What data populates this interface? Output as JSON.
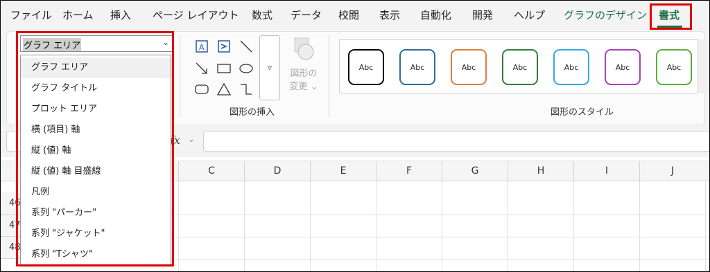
{
  "menu": {
    "items": [
      "ファイル",
      "ホーム",
      "挿入",
      "ページ レイアウト",
      "数式",
      "データ",
      "校閲",
      "表示",
      "自動化",
      "開発",
      "ヘルプ",
      "グラフのデザイン",
      "書式"
    ]
  },
  "ribbon": {
    "selection_combo_value": "グラフ エリア",
    "insert_shapes_label": "図形の挿入",
    "change_shape_label_1": "図形の",
    "change_shape_label_2": "変更",
    "shape_styles_label": "図形のスタイル",
    "style_swatches": [
      {
        "text": "Abc",
        "color": "#000000"
      },
      {
        "text": "Abc",
        "color": "#2e6b9e"
      },
      {
        "text": "Abc",
        "color": "#e07b39"
      },
      {
        "text": "Abc",
        "color": "#2f7d3b"
      },
      {
        "text": "Abc",
        "color": "#34a8e0"
      },
      {
        "text": "Abc",
        "color": "#a642b8"
      },
      {
        "text": "Abc",
        "color": "#5aad3a"
      }
    ]
  },
  "formula_bar": {
    "fx_label": "fx",
    "value": ""
  },
  "grid": {
    "columns": [
      "C",
      "D",
      "E",
      "F",
      "G",
      "H",
      "I",
      "J"
    ],
    "rows": [
      "46",
      "47",
      "48"
    ]
  },
  "dropdown": {
    "items": [
      "グラフ エリア",
      "グラフ タイトル",
      "プロット エリア",
      "横 (項目) 軸",
      "縦 (値) 軸",
      "縦 (値) 軸 目盛線",
      "凡例",
      "系列 \"パーカー\"",
      "系列 \"ジャケット\"",
      "系列 \"Tシャツ\""
    ]
  },
  "colors": {
    "accent_green": "#1e7145",
    "highlight_red": "#e00000"
  }
}
